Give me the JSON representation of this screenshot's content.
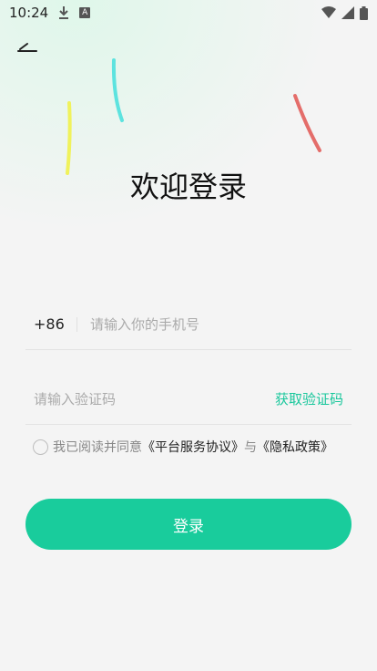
{
  "status": {
    "time": "10:24",
    "notif_a": "A"
  },
  "header": {
    "title": "欢迎登录"
  },
  "phone": {
    "country_code": "+86",
    "placeholder": "请输入你的手机号"
  },
  "code": {
    "placeholder": "请输入验证码",
    "get_code_label": "获取验证码"
  },
  "agreement": {
    "prefix": "我已阅读并同意",
    "terms": "《平台服务协议》",
    "joiner": "与",
    "privacy": "《隐私政策》"
  },
  "login": {
    "button_label": "登录"
  },
  "colors": {
    "accent": "#19cc9c",
    "link_green": "#19c79c"
  }
}
